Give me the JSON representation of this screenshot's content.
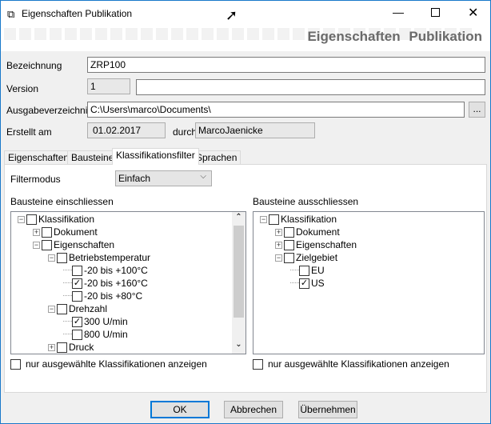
{
  "window": {
    "title": "Eigenschaften Publikation",
    "banner": "Eigenschaften Publikation"
  },
  "form": {
    "bezeichnung_label": "Bezeichnung",
    "bezeichnung": "ZRP100",
    "version_label": "Version",
    "version": "1",
    "version_extra": "",
    "ausgabe_label": "Ausgabeverzeichnis",
    "ausgabe": "C:\\Users\\marco\\Documents\\",
    "browse": "...",
    "erstellt_label": "Erstellt am",
    "erstellt": "01.02.2017",
    "durch_label": "durch",
    "durch": "MarcoJaenicke"
  },
  "tabs": [
    "Eigenschaften",
    "Bausteine",
    "Klassifikationsfilter",
    "Sprachen"
  ],
  "filter": {
    "label": "Filtermodus",
    "value": "Einfach"
  },
  "include": {
    "title": "Bausteine einschliessen",
    "checkbox": "nur ausgewählte Klassifikationen anzeigen",
    "items": [
      {
        "label": "Klassifikation",
        "level": 0,
        "exp": "-",
        "checked": false
      },
      {
        "label": "Dokument",
        "level": 1,
        "exp": "+",
        "checked": false
      },
      {
        "label": "Eigenschaften",
        "level": 1,
        "exp": "-",
        "checked": false
      },
      {
        "label": "Betriebstemperatur",
        "level": 2,
        "exp": "-",
        "checked": false
      },
      {
        "label": "-20 bis +100°C",
        "level": 3,
        "exp": "",
        "checked": false
      },
      {
        "label": "-20 bis +160°C",
        "level": 3,
        "exp": "",
        "checked": true
      },
      {
        "label": "-20 bis +80°C",
        "level": 3,
        "exp": "",
        "checked": false
      },
      {
        "label": "Drehzahl",
        "level": 2,
        "exp": "-",
        "checked": false
      },
      {
        "label": "300 U/min",
        "level": 3,
        "exp": "",
        "checked": true
      },
      {
        "label": "800 U/min",
        "level": 3,
        "exp": "",
        "checked": false
      },
      {
        "label": "Druck",
        "level": 2,
        "exp": "+",
        "checked": false
      }
    ]
  },
  "exclude": {
    "title": "Bausteine ausschliessen",
    "checkbox": "nur ausgewählte Klassifikationen anzeigen",
    "items": [
      {
        "label": "Klassifikation",
        "level": 0,
        "exp": "-",
        "checked": false
      },
      {
        "label": "Dokument",
        "level": 1,
        "exp": "+",
        "checked": false
      },
      {
        "label": "Eigenschaften",
        "level": 1,
        "exp": "+",
        "checked": false
      },
      {
        "label": "Zielgebiet",
        "level": 1,
        "exp": "-",
        "checked": false
      },
      {
        "label": "EU",
        "level": 2,
        "exp": "",
        "checked": false
      },
      {
        "label": "US",
        "level": 2,
        "exp": "",
        "checked": true
      }
    ]
  },
  "buttons": {
    "ok": "OK",
    "cancel": "Abbrechen",
    "apply": "Übernehmen"
  }
}
